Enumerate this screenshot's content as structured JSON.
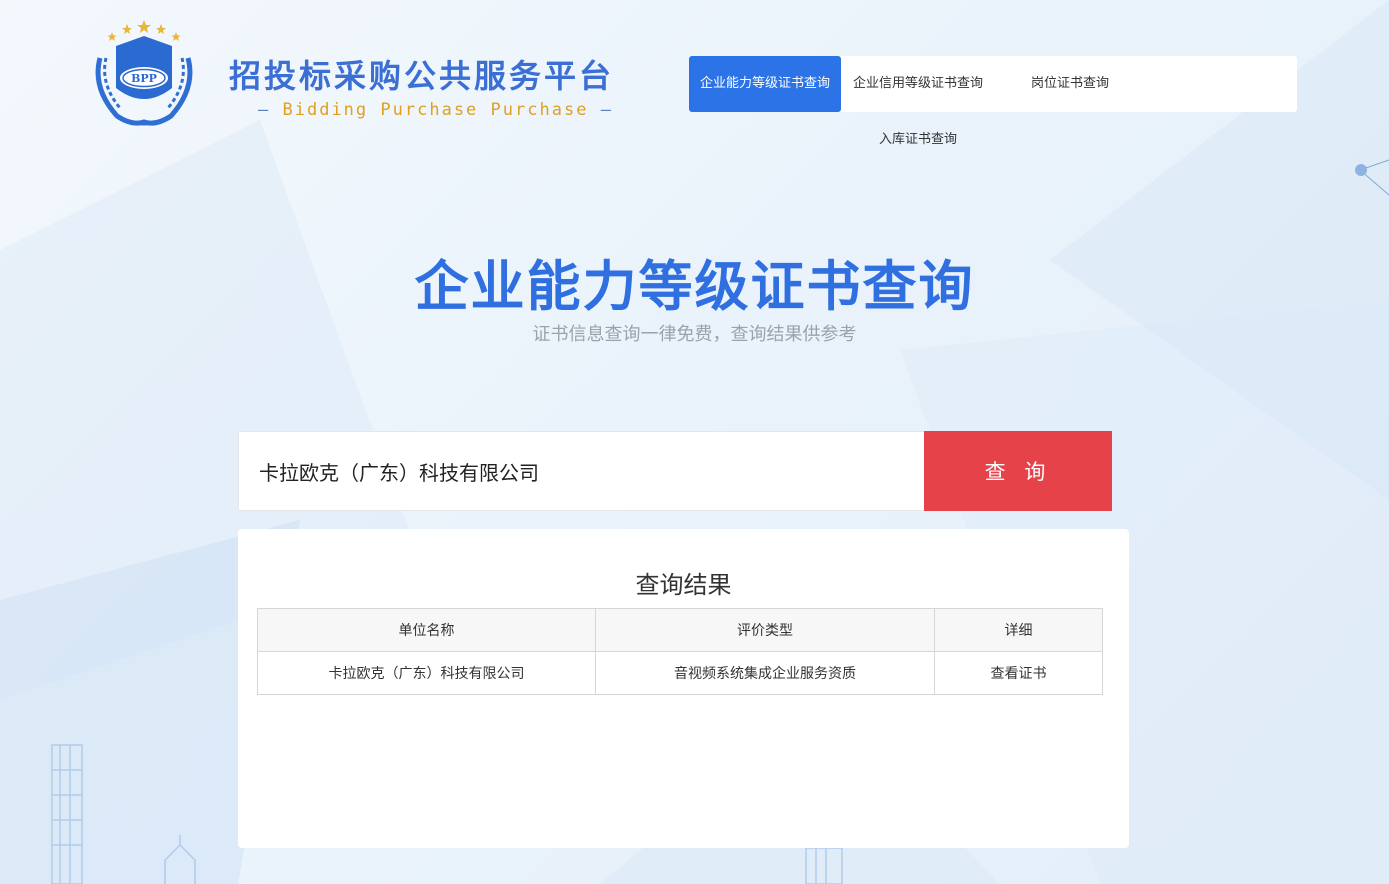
{
  "brand": {
    "title": "招投标采购公共服务平台",
    "subtitle_dash_left": "—",
    "subtitle_words": [
      "Bidding",
      "Purchase",
      "Purchase"
    ],
    "subtitle_dash_right": "—",
    "logo_text": "BPP"
  },
  "nav": {
    "items": [
      {
        "label": "企业能力等级证书查询",
        "active": true
      },
      {
        "label": "企业信用等级证书查询",
        "active": false
      },
      {
        "label": "岗位证书查询",
        "active": false
      },
      {
        "label": "入库证书查询",
        "active": false
      }
    ]
  },
  "hero": {
    "title": "企业能力等级证书查询",
    "subtitle": "证书信息查询一律免费，查询结果供参考"
  },
  "search": {
    "value": "卡拉欧克（广东）科技有限公司",
    "button_label": "查 询"
  },
  "results": {
    "title": "查询结果",
    "columns": [
      "单位名称",
      "评价类型",
      "详细"
    ],
    "rows": [
      [
        "卡拉欧克（广东）科技有限公司",
        "音视频系统集成企业服务资质",
        "查看证书"
      ]
    ]
  },
  "colors": {
    "accent": "#2b73e6",
    "title_blue": "#2f6fe0",
    "search_button": "#e5424a",
    "brand_gold": "#e0a020"
  },
  "icons": [
    "laurel-logo-icon",
    "star-icon"
  ]
}
